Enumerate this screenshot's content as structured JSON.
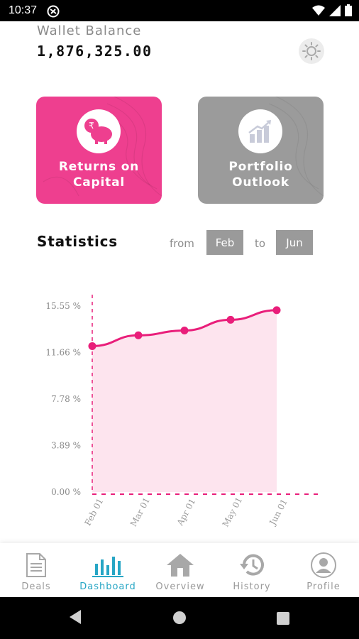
{
  "status_bar": {
    "time": "10:37"
  },
  "wallet": {
    "label": "Wallet Balance",
    "value": "1,876,325.00"
  },
  "cards": [
    {
      "title": "Returns on Capital",
      "icon": "piggy-bank-rupee-icon",
      "color": "#ee3f8f"
    },
    {
      "title": "Portfolio Outlook",
      "icon": "growth-chart-icon",
      "color": "#9b9b9b"
    }
  ],
  "statistics": {
    "title": "Statistics",
    "from_label": "from",
    "from_value": "Feb",
    "to_label": "to",
    "to_value": "Jun"
  },
  "chart_data": {
    "type": "area",
    "x": [
      "Feb 01",
      "Mar 01",
      "Apr 01",
      "May 01",
      "Jun 01"
    ],
    "series": [
      {
        "values": [
          12.2,
          13.1,
          13.5,
          14.4,
          15.2
        ]
      }
    ],
    "y_ticks": [
      "0.00 %",
      "3.89 %",
      "7.78 %",
      "11.66 %",
      "15.55 %"
    ],
    "ylim": [
      0,
      15.55
    ],
    "color": "#e91e7a"
  },
  "bottom_nav": [
    {
      "label": "Deals",
      "icon": "document-icon",
      "active": false
    },
    {
      "label": "Dashboard",
      "icon": "bar-chart-icon",
      "active": true
    },
    {
      "label": "Overview",
      "icon": "home-icon",
      "active": false
    },
    {
      "label": "History",
      "icon": "history-icon",
      "active": false
    },
    {
      "label": "Profile",
      "icon": "profile-icon",
      "active": false
    }
  ],
  "colors": {
    "accent": "#ee3f8f",
    "active_nav": "#27a6c5",
    "muted": "#9b9b9b"
  }
}
